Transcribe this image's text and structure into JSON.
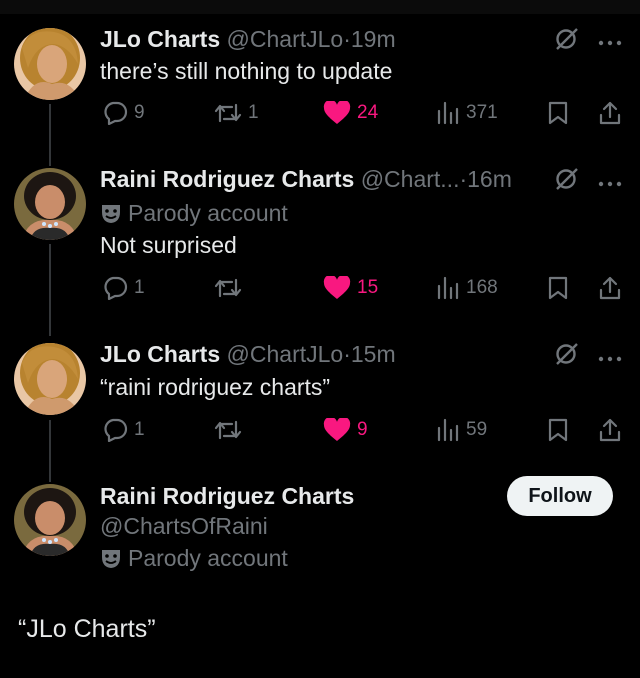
{
  "tweets": [
    {
      "name": "JLo Charts",
      "handle": "@ChartJLo",
      "dot": "·",
      "time": "19m",
      "text": "there’s still nothing to update",
      "replies": "9",
      "retweets": "1",
      "likes": "24",
      "views": "371"
    },
    {
      "name": "Raini Rodriguez Charts",
      "handle": "@Chart...",
      "dot": "·",
      "time": "16m",
      "parody": "Parody account",
      "text": "Not surprised",
      "replies": "1",
      "retweets": "",
      "likes": "15",
      "views": "168"
    },
    {
      "name": "JLo Charts",
      "handle": "@ChartJLo",
      "dot": "·",
      "time": "15m",
      "text": "“raini rodriguez charts”",
      "replies": "1",
      "retweets": "",
      "likes": "9",
      "views": "59"
    }
  ],
  "main": {
    "name": "Raini Rodriguez Charts",
    "handle": "@ChartsOfRaini",
    "parody": "Parody account",
    "follow": "Follow",
    "text": "“JLo Charts”"
  },
  "colors": {
    "like": "#f91880",
    "muted": "#71767b",
    "text": "#e7e9ea"
  }
}
